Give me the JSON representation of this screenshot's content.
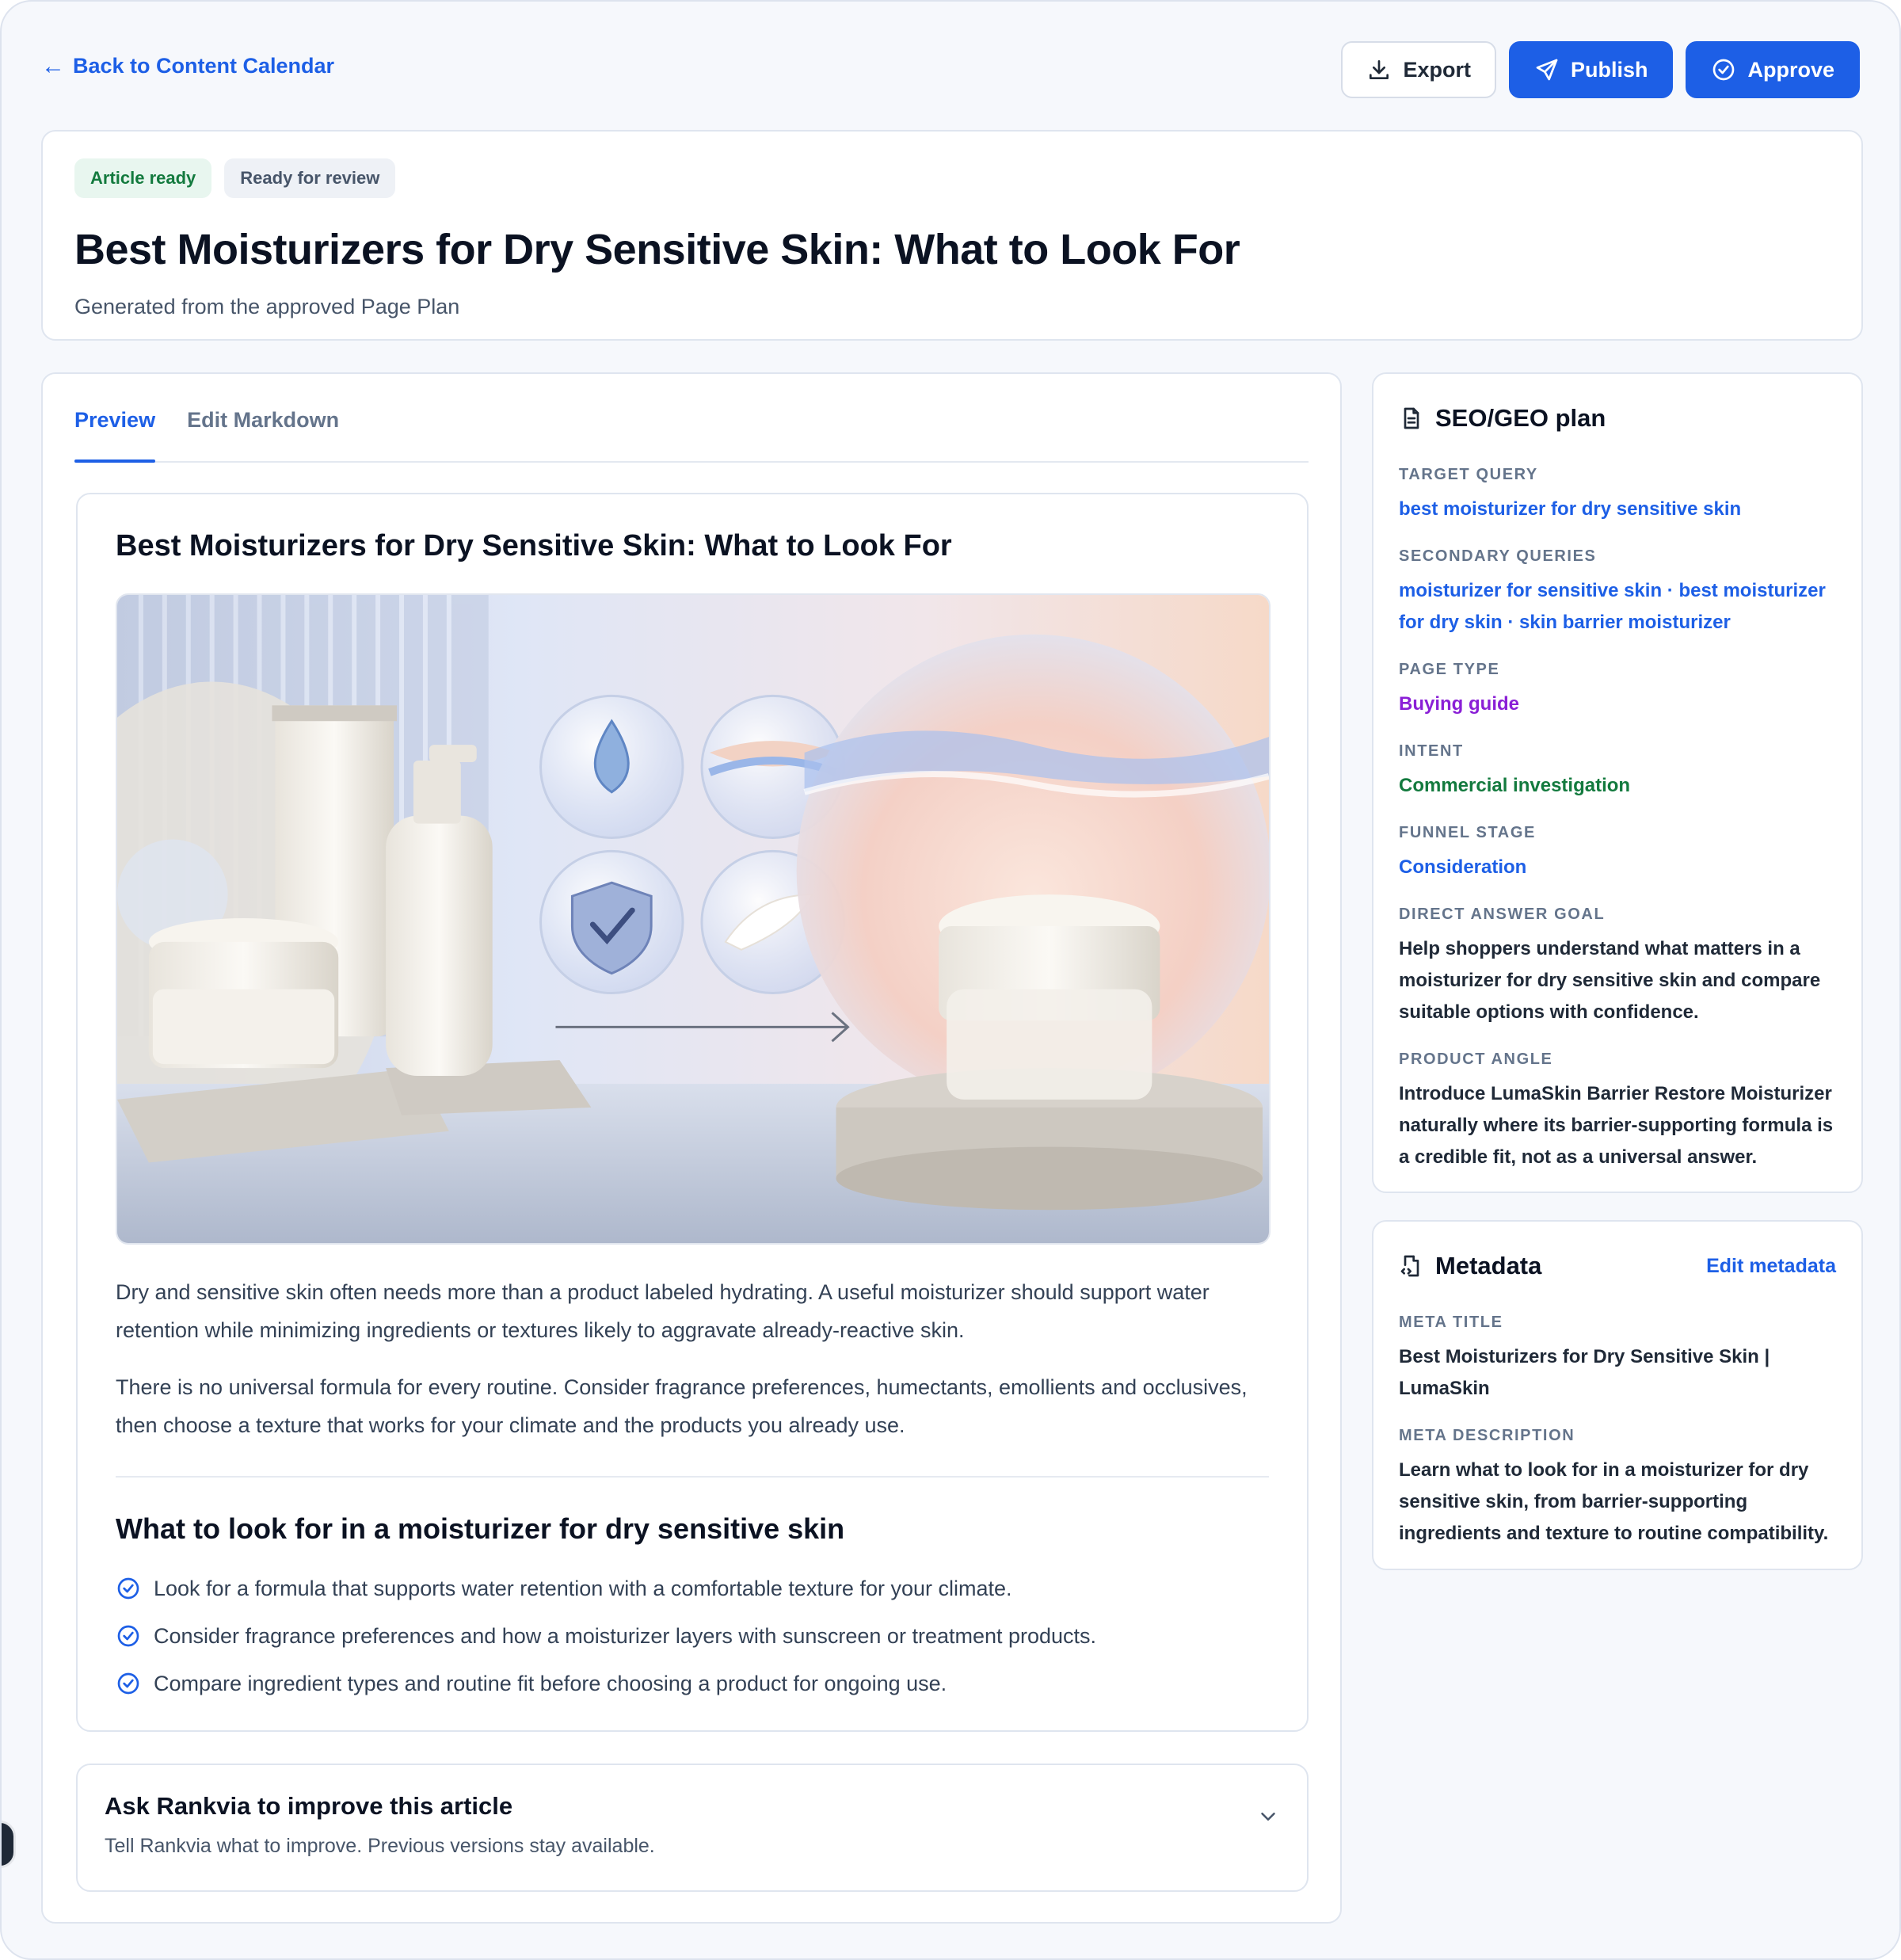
{
  "nav": {
    "back_label": "Back to Content Calendar",
    "export_label": "Export",
    "publish_label": "Publish",
    "approve_label": "Approve"
  },
  "header": {
    "badges": [
      "Article ready",
      "Ready for review"
    ],
    "title": "Best Moisturizers for Dry Sensitive Skin: What to Look For",
    "subtitle": "Generated from the approved Page Plan"
  },
  "tabs": [
    "Preview",
    "Edit Markdown"
  ],
  "article": {
    "title": "Best Moisturizers for Dry Sensitive Skin: What to Look For",
    "paragraphs": [
      "Dry and sensitive skin often needs more than a product labeled hydrating. A useful moisturizer should support water retention while minimizing ingredients or textures likely to aggravate already-reactive skin.",
      "There is no universal formula for every routine. Consider fragrance preferences, humectants, emollients and occlusives, then choose a texture that works for your climate and the products you already use."
    ],
    "section_heading": "What to look for in a moisturizer for dry sensitive skin",
    "checklist": [
      "Look for a formula that supports water retention with a comfortable texture for your climate.",
      "Consider fragrance preferences and how a moisturizer layers with sunscreen or treatment products.",
      "Compare ingredient types and routine fit before choosing a product for ongoing use."
    ]
  },
  "ask": {
    "title": "Ask Rankvia to improve this article",
    "subtitle": "Tell Rankvia what to improve. Previous versions stay available."
  },
  "seo_plan": {
    "title": "SEO/GEO plan",
    "fields": [
      {
        "label": "TARGET QUERY",
        "value": "best moisturizer for dry sensitive skin"
      },
      {
        "label": "SECONDARY QUERIES",
        "value": "moisturizer for sensitive skin · best moisturizer for dry skin · skin barrier moisturizer"
      },
      {
        "label": "PAGE TYPE",
        "value": "Buying guide"
      },
      {
        "label": "INTENT",
        "value": "Commercial investigation"
      },
      {
        "label": "FUNNEL STAGE",
        "value": "Consideration"
      },
      {
        "label": "DIRECT ANSWER GOAL",
        "value": "Help shoppers understand what matters in a moisturizer for dry sensitive skin and compare suitable options with confidence."
      },
      {
        "label": "PRODUCT ANGLE",
        "value": "Introduce LumaSkin Barrier Restore Moisturizer naturally where its barrier-supporting formula is a credible fit, not as a universal answer."
      }
    ]
  },
  "metadata": {
    "title": "Metadata",
    "edit_label": "Edit metadata",
    "fields": [
      {
        "label": "META TITLE",
        "value": "Best Moisturizers for Dry Sensitive Skin | LumaSkin"
      },
      {
        "label": "META DESCRIPTION",
        "value": "Learn what to look for in a moisturizer for dry sensitive skin, from barrier-supporting ingredients and texture to routine compatibility."
      }
    ]
  },
  "colors": {
    "accent": "#1d5fe6",
    "success": "#137a3e",
    "purple": "#8a1fd6"
  },
  "icons": [
    "arrow-left-icon",
    "download-icon",
    "send-icon",
    "check-circle-icon",
    "document-icon",
    "file-code-icon",
    "chevron-down-icon"
  ]
}
